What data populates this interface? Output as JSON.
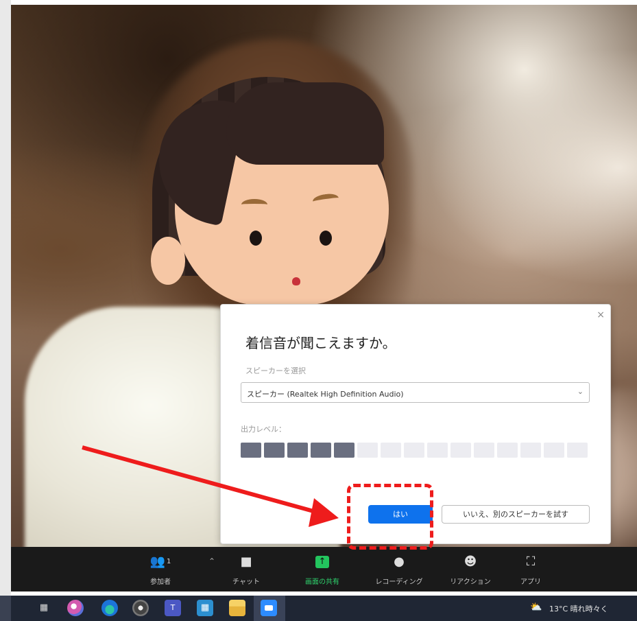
{
  "dialog": {
    "title": "着信音が聞こえますか。",
    "close_icon": "×",
    "speaker_label": "スピーカーを選択",
    "speaker_value": "スピーカー (Realtek High Definition Audio)",
    "output_level_label": "出力レベル：",
    "output_level": 0.33,
    "level_segments_total": 15,
    "level_segments_on": 5,
    "yes_label": "はい",
    "no_label": "いいえ、別のスピーカーを試す"
  },
  "toolbar": {
    "participants_label": "参加者",
    "participants_count": "1",
    "chat_label": "チャット",
    "share_label": "画面の共有",
    "record_label": "レコーディング",
    "reactions_label": "リアクション",
    "apps_label": "アプリ"
  },
  "taskbar": {
    "weather": "13°C 晴れ時々く"
  },
  "colors": {
    "primary_button": "#0e72ed",
    "share_green": "#23c55e",
    "annotation_red": "#ee1c1c",
    "toolbar_bg": "#1a1a1a"
  }
}
